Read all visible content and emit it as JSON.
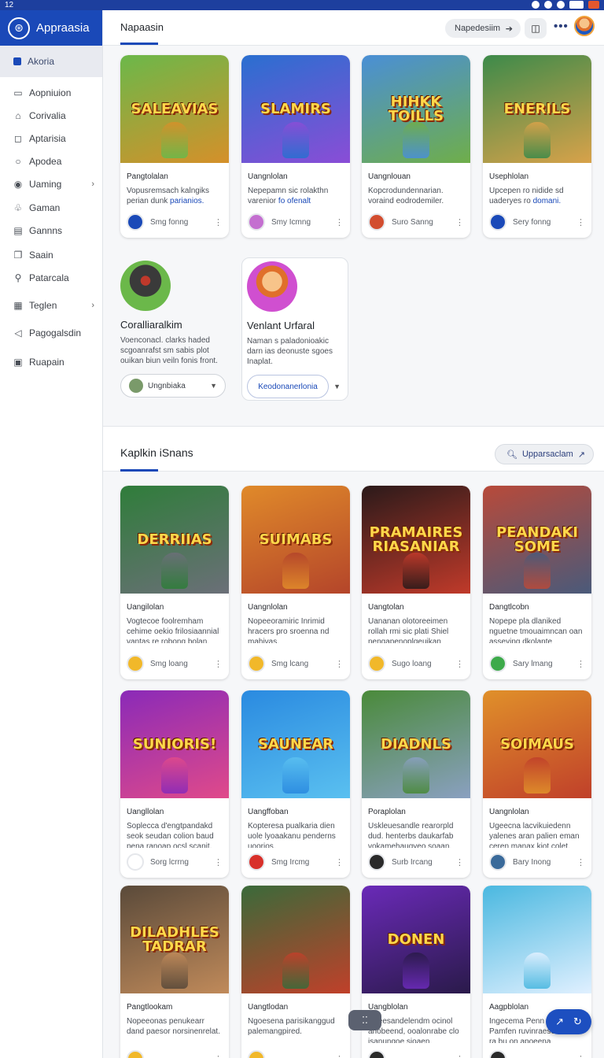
{
  "status": {
    "time": "12"
  },
  "sidebar": {
    "brand": "Appraasia",
    "active": "Akoria",
    "items": [
      {
        "label": "Aopniuion",
        "icon": "square-icon",
        "glyph": "▭",
        "chevron": false
      },
      {
        "label": "Corivalia",
        "icon": "home-icon",
        "glyph": "⌂",
        "chevron": false
      },
      {
        "label": "Aptarisia",
        "icon": "chat-icon",
        "glyph": "◻",
        "chevron": false
      },
      {
        "label": "Apodea",
        "icon": "circle-icon",
        "glyph": "○",
        "chevron": false
      },
      {
        "label": "Uaming",
        "icon": "info-icon",
        "glyph": "◉",
        "chevron": true
      },
      {
        "label": "Gaman",
        "icon": "gamepad-icon",
        "glyph": "♧",
        "chevron": false
      },
      {
        "label": "Gannns",
        "icon": "grid-icon",
        "glyph": "▤",
        "chevron": false
      },
      {
        "label": "Saain",
        "icon": "copy-icon",
        "glyph": "❐",
        "chevron": false
      },
      {
        "label": "Patarcala",
        "icon": "pin-icon",
        "glyph": "⚲",
        "chevron": false
      },
      {
        "label": "Teglen",
        "icon": "calendar-icon",
        "glyph": "▦",
        "chevron": true
      },
      {
        "label": "Pagogalsdin",
        "icon": "send-icon",
        "glyph": "◁",
        "chevron": false
      },
      {
        "label": "Ruapain",
        "icon": "list-icon",
        "glyph": "▣",
        "chevron": false
      }
    ]
  },
  "header": {
    "tab": "Napaasin",
    "search_label": "Napedesiim",
    "more": "•••"
  },
  "top_cards": [
    {
      "thumb": "SALEAVIAS",
      "title": "Pangtolalan",
      "desc": "Vopusremsach kalngiks perian dunk",
      "link": "parianios.",
      "foot": "Smg fonng",
      "colors": [
        "#6bb84a",
        "#d5902a"
      ],
      "badge": "#1a49b8"
    },
    {
      "thumb": "SLAMIRS",
      "title": "Uangnlolan",
      "desc": "Nepepamn sic rolakthn varenior",
      "link": "fo ofenalt",
      "foot": "Smy Icmng",
      "colors": [
        "#2a6fd0",
        "#8a4dd6"
      ],
      "badge": "#c46fd0"
    },
    {
      "thumb": "HIHKK TOILLS",
      "title": "Uangnlouan",
      "desc": "Kopcrodundennarian. voraind eodrodemiler.",
      "link": "",
      "foot": "Suro Sanng",
      "colors": [
        "#4a8fd6",
        "#6fae4a"
      ],
      "badge": "#d24d2f"
    },
    {
      "thumb": "ENERILS",
      "title": "Usephlolan",
      "desc": "Upcepen ro nidide sd uaderyes ro",
      "link": "domani.",
      "foot": "Sery fonng",
      "colors": [
        "#3d8a4a",
        "#d8a24a"
      ],
      "badge": "#1a49b8"
    }
  ],
  "featured": [
    {
      "title": "Coralliaralkim",
      "desc": "Voenconacl. clarks haded scgoanrafst sm sabis plot ouikan biun veiln fonis front.",
      "select": "Ungnbiaka"
    },
    {
      "title": "Venlant Urfaral",
      "desc": "Naman s paladonioakic darn ias deonuste sgoes Inaplat.",
      "select": "Keodonanerlonia"
    }
  ],
  "section": {
    "title": "Kaplkin iSnans",
    "button": "Upparsaclam"
  },
  "cards": [
    {
      "thumb": "DERRIIAS",
      "title": "Uangilolan",
      "desc": "Vogtecoe foolremham cehime oekio frilosiaannial vantas re robong bolan.",
      "foot": "Smg loang",
      "colors": [
        "#2f7d3a",
        "#6b6f78"
      ],
      "badge": "#f1b82a"
    },
    {
      "thumb": "SUIMABS",
      "title": "Uangnlolan",
      "desc": "Nopeeoramiric Inrimid hracers pro sroenna nd mahivas.",
      "foot": "Smg lcang",
      "colors": [
        "#e08a2a",
        "#b4452a"
      ],
      "badge": "#f1b82a"
    },
    {
      "thumb": "PRAMAIRES RIASANIAR",
      "title": "Uangtolan",
      "desc": "Uananan olotoreeimen rollah rmi sic plati Shiel nengapenoplgeuikan",
      "foot": "Sugo loang",
      "colors": [
        "#2b1a1a",
        "#c03a2a"
      ],
      "badge": "#f1b82a"
    },
    {
      "thumb": "PEANDAKI SOME",
      "title": "Dangtlcobn",
      "desc": "Nopepe pla dlaniked nguetne tmouaimncan oan asseving dkolante",
      "foot": "Sary lmang",
      "colors": [
        "#b84a3a",
        "#4a5a7a"
      ],
      "badge": "#3daa4a"
    },
    {
      "thumb": "SUNIORIS!",
      "title": "Uangllolan",
      "desc": "Soplecca d'engtpandakd seok seudan colion baud pena ranoap ocsl scanit.",
      "foot": "Sorg lcrrng",
      "colors": [
        "#8a2ab8",
        "#e04a8a"
      ],
      "badge": "#ffffff"
    },
    {
      "thumb": "SAUNEAR",
      "title": "Uangffoban",
      "desc": "Kopteresa pualkaria dien uole lyoaakanu penderns uoorios.",
      "foot": "Smg Ircmg",
      "colors": [
        "#2a8ae0",
        "#5ac0f0"
      ],
      "badge": "#d8302a"
    },
    {
      "thumb": "DIADNLS",
      "title": "Poraplolan",
      "desc": "Uskleuesandle rearorpld dud. henterbs daukarfab vokamehaugyeo soaan.",
      "foot": "Surb Ircang",
      "colors": [
        "#4a8a3a",
        "#8aa0c0"
      ],
      "badge": "#2a2a2a"
    },
    {
      "thumb": "SOIMAUS",
      "title": "Uangnlolan",
      "desc": "Ugeecna lacvikuiedenn yalenes aran palien eman ceren manax kiot colet.",
      "foot": "Bary Inong",
      "colors": [
        "#e0902a",
        "#c0402a"
      ],
      "badge": "#3a6a9a"
    },
    {
      "thumb": "DILADHLES TADRAR",
      "title": "Pangtlookam",
      "desc": "Nopeeonas penukearr dand paesor norsinenrelat.",
      "foot": "",
      "colors": [
        "#5a4a3a",
        "#c08a5a"
      ],
      "badge": "#f1b82a"
    },
    {
      "thumb": "",
      "title": "Uangtlodan",
      "desc": "Ngoesena parisikanggud palemangpired.",
      "foot": "",
      "colors": [
        "#3a6a3a",
        "#c0402a"
      ],
      "badge": "#f1b82a"
    },
    {
      "thumb": "DONEN",
      "title": "Uangblolan",
      "desc": "Uoeesandelendm ocinol anobeend, ooalonrabe clo isanungoe sioaen.",
      "foot": "",
      "colors": [
        "#6a2ab8",
        "#2a1a4a"
      ],
      "badge": "#2a2a2a"
    },
    {
      "thumb": "",
      "title": "Aagpblolan",
      "desc": "Ingecema Penn ppmnn Pamfen ruvinraeset cmes ra bu on apoeena",
      "foot": "",
      "colors": [
        "#4ab8e0",
        "#e0f0ff"
      ],
      "badge": "#2a2a2a"
    }
  ],
  "float_center_label": "⁚⁚",
  "fab": {
    "left": "↗",
    "right": "↻"
  }
}
